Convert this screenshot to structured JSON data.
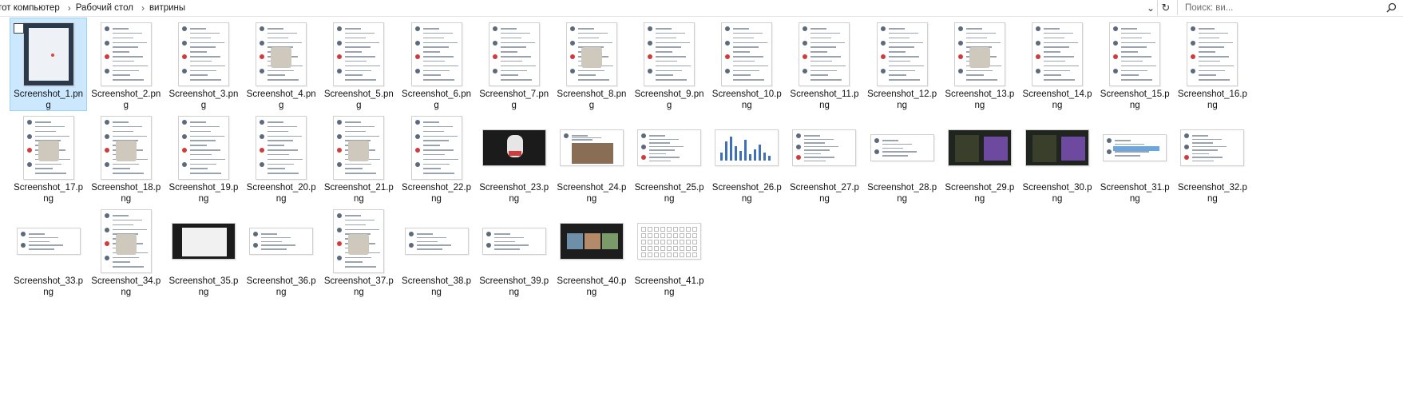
{
  "address_bar": {
    "breadcrumbs": [
      "тот компьютер",
      "Рабочий стол",
      "витрины"
    ],
    "search_placeholder": "Поиск: ви..."
  },
  "files": [
    {
      "name": "Screenshot_1.png",
      "selected": true,
      "kind": "portrait-blue"
    },
    {
      "name": "Screenshot_2.png",
      "kind": "portrait"
    },
    {
      "name": "Screenshot_3.png",
      "kind": "portrait"
    },
    {
      "name": "Screenshot_4.png",
      "kind": "portrait-img"
    },
    {
      "name": "Screenshot_5.png",
      "kind": "portrait"
    },
    {
      "name": "Screenshot_6.png",
      "kind": "portrait"
    },
    {
      "name": "Screenshot_7.png",
      "kind": "portrait"
    },
    {
      "name": "Screenshot_8.png",
      "kind": "portrait-img"
    },
    {
      "name": "Screenshot_9.png",
      "kind": "portrait"
    },
    {
      "name": "Screenshot_10.png",
      "kind": "portrait"
    },
    {
      "name": "Screenshot_11.png",
      "kind": "portrait"
    },
    {
      "name": "Screenshot_12.png",
      "kind": "portrait"
    },
    {
      "name": "Screenshot_13.png",
      "kind": "portrait-img"
    },
    {
      "name": "Screenshot_14.png",
      "kind": "portrait"
    },
    {
      "name": "Screenshot_15.png",
      "kind": "portrait"
    },
    {
      "name": "Screenshot_16.png",
      "kind": "portrait"
    },
    {
      "name": "Screenshot_17.png",
      "kind": "portrait-img"
    },
    {
      "name": "Screenshot_18.png",
      "kind": "portrait-img"
    },
    {
      "name": "Screenshot_19.png",
      "kind": "portrait"
    },
    {
      "name": "Screenshot_20.png",
      "kind": "portrait"
    },
    {
      "name": "Screenshot_21.png",
      "kind": "portrait-img"
    },
    {
      "name": "Screenshot_22.png",
      "kind": "portrait"
    },
    {
      "name": "Screenshot_23.png",
      "kind": "land-dark"
    },
    {
      "name": "Screenshot_24.png",
      "kind": "land-img"
    },
    {
      "name": "Screenshot_25.png",
      "kind": "land"
    },
    {
      "name": "Screenshot_26.png",
      "kind": "land-chart"
    },
    {
      "name": "Screenshot_27.png",
      "kind": "land"
    },
    {
      "name": "Screenshot_28.png",
      "kind": "short"
    },
    {
      "name": "Screenshot_29.png",
      "kind": "land-game"
    },
    {
      "name": "Screenshot_30.png",
      "kind": "land-game"
    },
    {
      "name": "Screenshot_31.png",
      "kind": "short-blue"
    },
    {
      "name": "Screenshot_32.png",
      "kind": "land"
    },
    {
      "name": "Screenshot_33.png",
      "kind": "short"
    },
    {
      "name": "Screenshot_34.png",
      "kind": "portrait-img"
    },
    {
      "name": "Screenshot_35.png",
      "kind": "land-dark-ui"
    },
    {
      "name": "Screenshot_36.png",
      "kind": "short"
    },
    {
      "name": "Screenshot_37.png",
      "kind": "portrait-img"
    },
    {
      "name": "Screenshot_38.png",
      "kind": "short"
    },
    {
      "name": "Screenshot_39.png",
      "kind": "short"
    },
    {
      "name": "Screenshot_40.png",
      "kind": "land-video"
    },
    {
      "name": "Screenshot_41.png",
      "kind": "land-grid"
    }
  ],
  "colors": {
    "selection_bg": "#cce8ff",
    "selection_border": "#99d1ff",
    "line": "#9aa4b0"
  }
}
